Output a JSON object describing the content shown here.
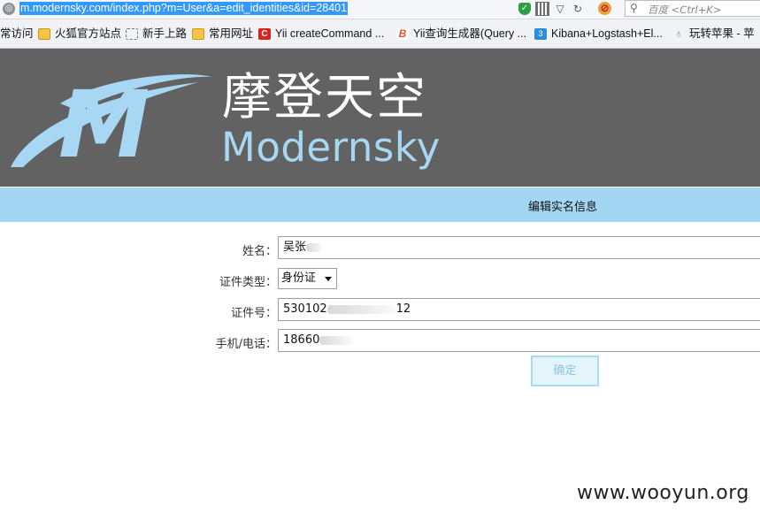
{
  "browser": {
    "url": "m.modernsky.com/index.php?m=User&a=edit_identities&id=28401",
    "search_placeholder": "百度 <Ctrl+K>"
  },
  "bookmarks": [
    {
      "label": "常访问",
      "icon": "none"
    },
    {
      "label": "火狐官方站点",
      "icon": "folder-icon"
    },
    {
      "label": "新手上路",
      "icon": "page-icon"
    },
    {
      "label": "常用网址",
      "icon": "folder-icon"
    },
    {
      "label": "Yii createCommand ...",
      "icon": "c-logo-icon"
    },
    {
      "label": "Yii查询生成器(Query ...",
      "icon": "b-logo-icon"
    },
    {
      "label": "Kibana+Logstash+El...",
      "icon": "three-logo-icon"
    },
    {
      "label": "玩转苹果 - 苹",
      "icon": "apple-icon"
    }
  ],
  "header": {
    "brand_cn": "摩登天空",
    "brand_en": "Modernsky",
    "logo_letter": "M"
  },
  "page": {
    "title": "编辑实名信息"
  },
  "form": {
    "name_label": "姓名：",
    "name_value": "吴张",
    "idtype_label": "证件类型：",
    "idtype_value": "身份证",
    "idno_label": "证件号：",
    "idno_value_start": "530102",
    "idno_value_end": "12",
    "phone_label": "手机/电话：",
    "phone_value": "18660",
    "submit_label": "确定"
  },
  "watermark": "www.wooyun.org",
  "colors": {
    "header_bg": "#626262",
    "brand_blue": "#a8d7f3",
    "title_band": "#a3d6f3",
    "url_highlight": "#3399ff"
  }
}
